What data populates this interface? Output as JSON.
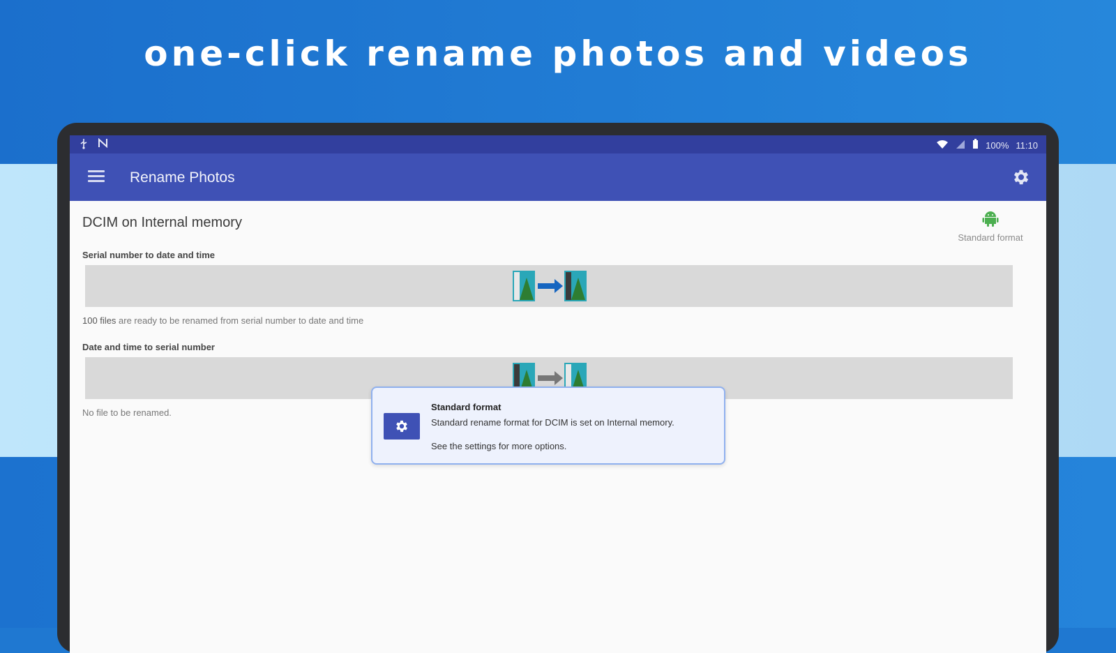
{
  "headline": "one-click rename photos and videos",
  "status_bar": {
    "battery": "100%",
    "time": "11:10"
  },
  "app_bar": {
    "title": "Rename Photos"
  },
  "main": {
    "storage_title": "DCIM on Internal memory",
    "format_badge_label": "Standard format",
    "sections": [
      {
        "label": "Serial number to date and time",
        "status_count": "100 files",
        "status_rest": " are ready to be renamed from serial number to date and time"
      },
      {
        "label": "Date and time to serial number",
        "status": "No file to be renamed."
      }
    ]
  },
  "dialog": {
    "title": "Standard format",
    "message": "Standard rename format for DCIM is set on Internal memory.",
    "hint": "See the settings for more options."
  },
  "colors": {
    "app_bar": "#3f51b5",
    "status_bar": "#323f9e",
    "accent_arrow": "#1565c0",
    "android_green": "#4caf50"
  }
}
